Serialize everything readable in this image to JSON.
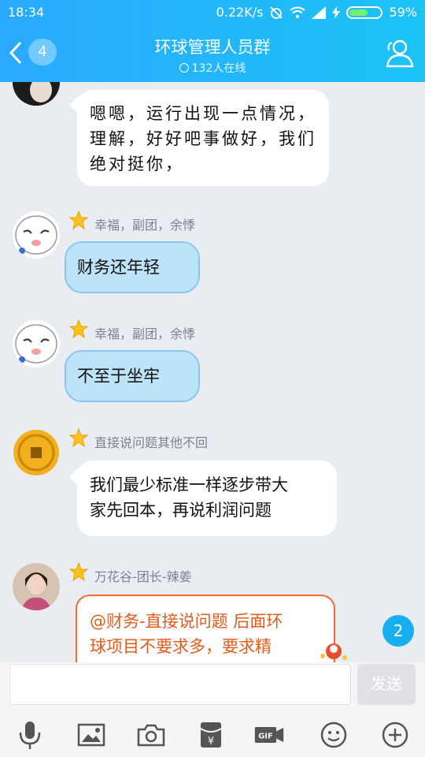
{
  "status_bar": {
    "time": "18:34",
    "speed": "0.22K/s",
    "battery": "59%",
    "battery_fraction": 0.59
  },
  "header": {
    "title": "环球管理人员群",
    "online": "132人在线",
    "unread": "4"
  },
  "messages": [
    {
      "sender": "",
      "text_lines": [
        "嗯嗯，运行出现一点情况，",
        "理解，好好吧事做好，我们",
        "绝对挺你，"
      ]
    },
    {
      "sender": "幸福，副团，余悸",
      "text": "财务还年轻"
    },
    {
      "sender": "幸福，副团，余悸",
      "text": "不至于坐牢"
    },
    {
      "sender": "直接说问题其他不回",
      "text_lines": [
        "我们最少标准一样逐步带大",
        "家先回本，再说利润问题"
      ]
    },
    {
      "sender": "万花谷-团长-辣姜",
      "text_lines": [
        "@财务-直接说问题 后面环",
        "球项目不要求多，要求精"
      ]
    }
  ],
  "new_message_badge": "2",
  "input": {
    "placeholder": "",
    "send_label": "发送"
  },
  "toolbar": [
    "mic-icon",
    "image-icon",
    "camera-icon",
    "red-packet-icon",
    "gif-icon",
    "emoji-icon",
    "plus-icon"
  ],
  "colors": {
    "header_start": "#2aa9ff",
    "header_end": "#1cc3f5",
    "bubble_blue": "#bde3f8",
    "bubble_orange_border": "#ef6a2e",
    "badge": "#19aef0"
  }
}
